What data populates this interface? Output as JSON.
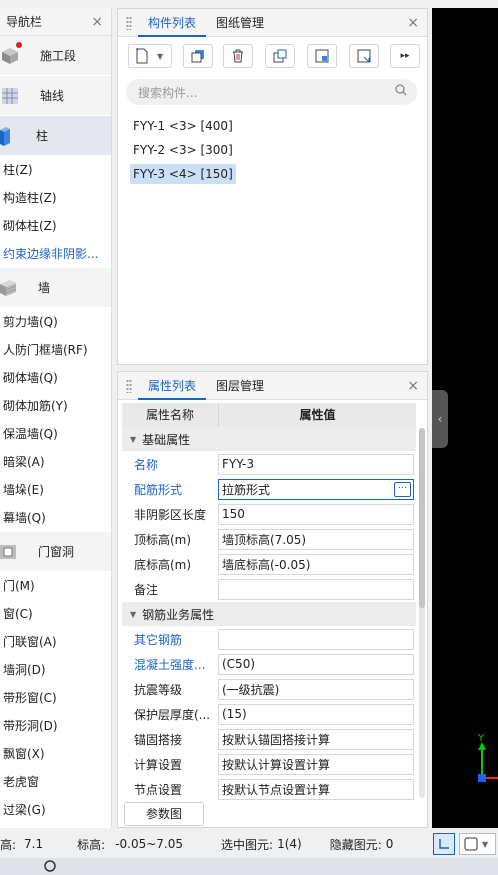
{
  "nav": {
    "title": "导航栏",
    "close": "×",
    "categories": [
      {
        "label": "施工段"
      },
      {
        "label": "轴线"
      },
      {
        "label": "柱"
      },
      {
        "label": "墙"
      },
      {
        "label": "门窗洞"
      }
    ],
    "col_items": [
      "柱(Z)",
      "构造柱(Z)",
      "砌体柱(Z)",
      "约束边缘非阴影..."
    ],
    "wall_items": [
      "剪力墙(Q)",
      "人防门框墙(RF)",
      "砌体墙(Q)",
      "砌体加筋(Y)",
      "保温墙(Q)",
      "暗梁(A)",
      "墙垛(E)",
      "幕墙(Q)"
    ],
    "door_items": [
      "门(M)",
      "窗(C)",
      "门联窗(A)",
      "墙洞(D)",
      "带形窗(C)",
      "带形洞(D)",
      "飘窗(X)",
      "老虎窗",
      "过梁(G)"
    ]
  },
  "top_panel": {
    "tabs": [
      "构件列表",
      "图纸管理"
    ],
    "close": "×",
    "search_placeholder": "搜索构件...",
    "components": [
      "FYY-1 <3> [400]",
      "FYY-2 <3> [300]",
      "FYY-3 <4> [150]"
    ],
    "selected_index": 2
  },
  "prop_panel": {
    "tabs": [
      "属性列表",
      "图层管理"
    ],
    "close": "×",
    "header_name": "属性名称",
    "header_value": "属性值",
    "group1": "基础属性",
    "group2": "钢筋业务属性",
    "rows1": [
      {
        "name": "名称",
        "value": "FYY-3"
      },
      {
        "name": "配筋形式",
        "value": "拉筋形式"
      },
      {
        "name": "非阴影区长度",
        "value": "150"
      },
      {
        "name": "顶标高(m)",
        "value": "墙顶标高(7.05)"
      },
      {
        "name": "底标高(m)",
        "value": "墙底标高(-0.05)"
      },
      {
        "name": "备注",
        "value": ""
      }
    ],
    "rows2": [
      {
        "name": "其它钢筋",
        "value": ""
      },
      {
        "name": "混凝土强度...",
        "value": "(C50)"
      },
      {
        "name": "抗震等级",
        "value": "(一级抗震)"
      },
      {
        "name": "保护层厚度(...",
        "value": "(15)"
      },
      {
        "name": "锚固搭接",
        "value": "按默认锚固搭接计算"
      },
      {
        "name": "计算设置",
        "value": "按默认计算设置计算"
      },
      {
        "name": "节点设置",
        "value": "按默认节点设置计算"
      }
    ],
    "dots": "···",
    "param_button": "参数图"
  },
  "status": {
    "elev_label": "高:",
    "elev_value": "7.1",
    "range_label": "标高:",
    "range_value": "-0.05~7.05",
    "selected_label": "选中图元:",
    "selected_value": "1(4)",
    "hidden_label": "隐藏图元:",
    "hidden_value": "0"
  },
  "axis": {
    "y": "Y"
  },
  "colors": {
    "accent": "#1a63c7",
    "selected": "#cbe0f7",
    "viewport": "#000000"
  }
}
